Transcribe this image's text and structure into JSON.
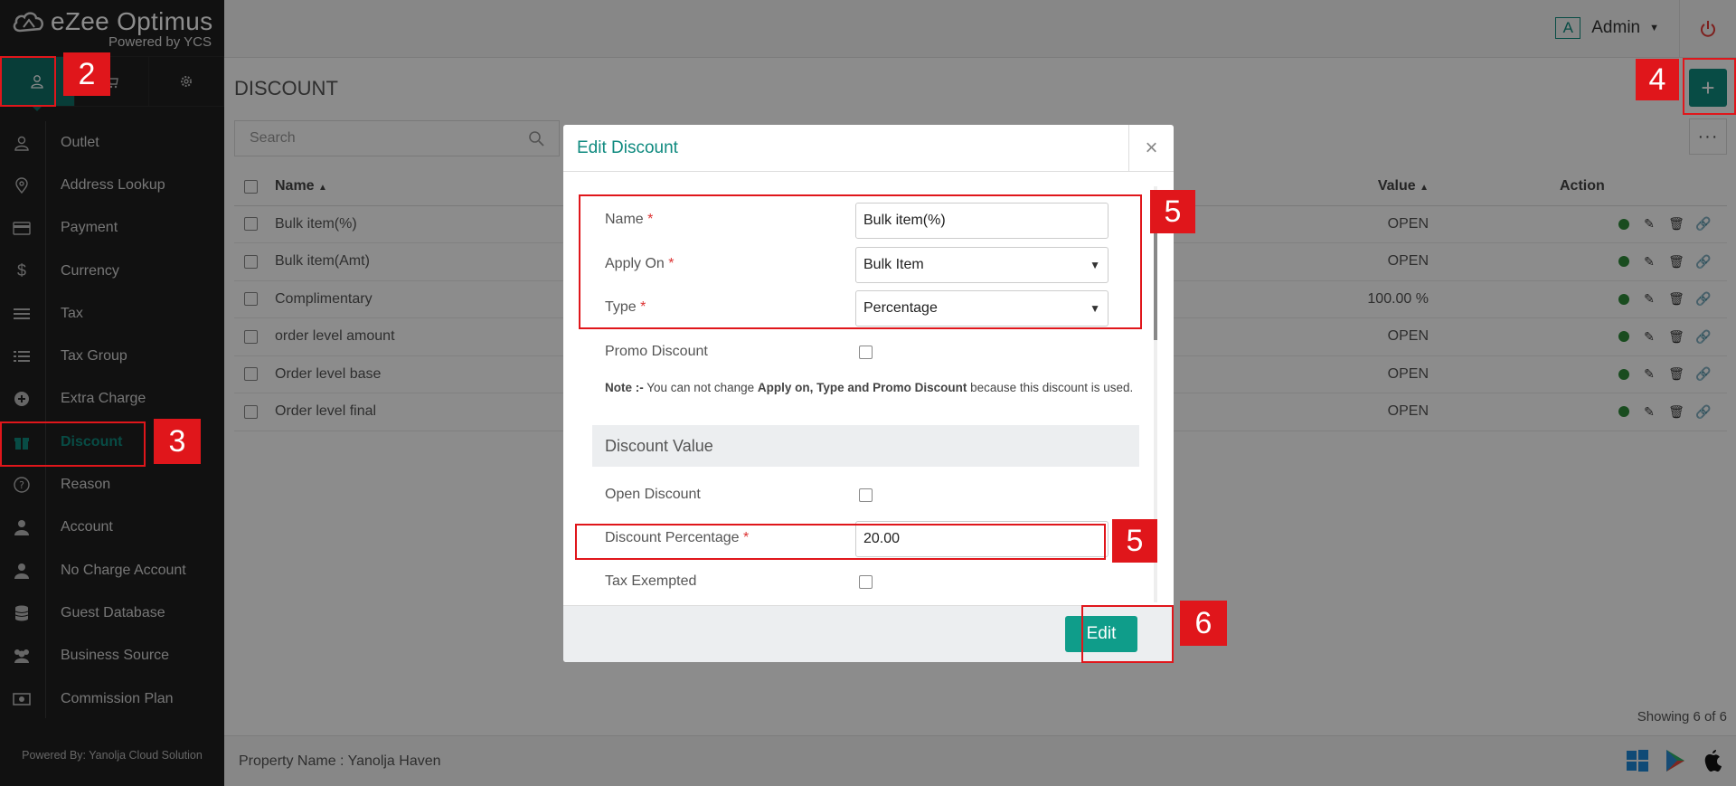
{
  "app": {
    "brand": "eZee Optimus",
    "brand_sub": "Powered by YCS",
    "sidebar_footer": "Powered By: Yanolja Cloud Solution"
  },
  "module_tabs": [
    {
      "icon": "user-icon"
    },
    {
      "icon": "cart-icon"
    },
    {
      "icon": "gear-icon"
    }
  ],
  "sidebar": {
    "items": [
      {
        "label": "Outlet",
        "icon": "user-icon"
      },
      {
        "label": "Address Lookup",
        "icon": "location-icon"
      },
      {
        "label": "Payment",
        "icon": "card-icon"
      },
      {
        "label": "Currency",
        "icon": "dollar-icon"
      },
      {
        "label": "Tax",
        "icon": "bars-icon"
      },
      {
        "label": "Tax Group",
        "icon": "list-icon"
      },
      {
        "label": "Extra Charge",
        "icon": "plus-circle-icon"
      },
      {
        "label": "Discount",
        "icon": "gift-icon"
      },
      {
        "label": "Reason",
        "icon": "question-icon"
      },
      {
        "label": "Account",
        "icon": "person-icon"
      },
      {
        "label": "No Charge Account",
        "icon": "person-icon"
      },
      {
        "label": "Guest Database",
        "icon": "database-icon"
      },
      {
        "label": "Business Source",
        "icon": "users-icon"
      },
      {
        "label": "Commission Plan",
        "icon": "money-icon"
      }
    ]
  },
  "topbar": {
    "avatar_letter": "A",
    "user": "Admin"
  },
  "page": {
    "title": "DISCOUNT",
    "add_label": "+",
    "search_placeholder": "Search",
    "more_label": "···",
    "columns": {
      "name": "Name",
      "value": "Value",
      "action": "Action"
    },
    "rows": [
      {
        "name": "Bulk item(%)",
        "value": "OPEN"
      },
      {
        "name": "Bulk item(Amt)",
        "value": "OPEN"
      },
      {
        "name": "Complimentary",
        "value": "100.00 %"
      },
      {
        "name": "order level amount",
        "value": "OPEN"
      },
      {
        "name": "Order level base",
        "value": "OPEN"
      },
      {
        "name": "Order level final",
        "value": "OPEN"
      }
    ],
    "showing": "Showing 6 of 6",
    "property": "Property Name : Yanolja Haven"
  },
  "modal": {
    "title": "Edit Discount",
    "close": "×",
    "name_label": "Name",
    "name_value": "Bulk item(%)",
    "apply_on_label": "Apply On",
    "apply_on_value": "Bulk Item",
    "type_label": "Type",
    "type_value": "Percentage",
    "promo_label": "Promo Discount",
    "note_prefix": "Note :-",
    "note_text_1": " You can not change ",
    "note_bold": "Apply on, Type and Promo Discount",
    "note_text_2": " because this discount is used.",
    "section_title": "Discount Value",
    "open_label": "Open Discount",
    "pct_label": "Discount Percentage",
    "pct_value": "20.00",
    "tax_label": "Tax Exempted",
    "required_mark": "*",
    "edit_button": "Edit"
  },
  "annotations": {
    "tag_2": "2",
    "tag_3": "3",
    "tag_4": "4",
    "tag_5a": "5",
    "tag_5b": "5",
    "tag_6": "6"
  },
  "colors": {
    "accent": "#0f8a7f",
    "sidebar_bg": "#1f1f1f",
    "annotation": "#e0161b"
  }
}
